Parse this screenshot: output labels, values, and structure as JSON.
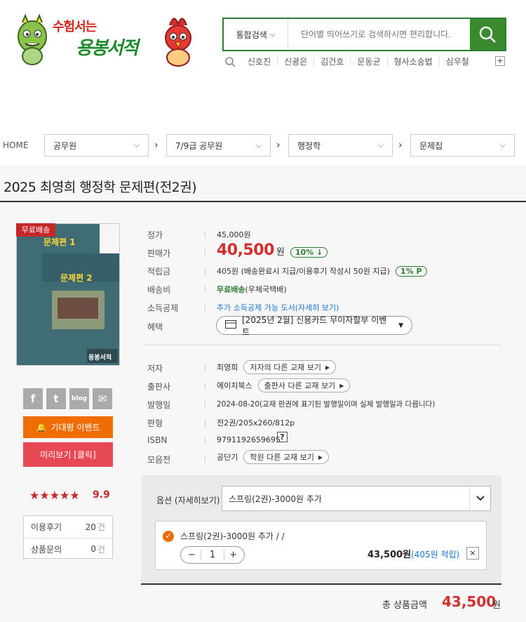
{
  "header": {
    "logo_line1": "수험서는",
    "logo_line2": "용봉서적",
    "search_scope": "통합검색",
    "search_placeholder": "단어별 띄어쓰기로 검색하시면 편리합니다.",
    "keywords": [
      "신호진",
      "신광은",
      "김건호",
      "문동균",
      "형사소송법",
      "심우철"
    ],
    "more_label": "+"
  },
  "breadcrumb": {
    "home": "HOME",
    "levels": [
      "공무원",
      "7/9급 공무원",
      "행정학",
      "문제집"
    ]
  },
  "product": {
    "title": "2025 최영희 행정학 문제편(전2권)",
    "free_badge": "무료배송",
    "cover_vol1": "문제편 1",
    "cover_vol2": "문제편 2",
    "cover_logo": "용봉서적",
    "fields": {
      "list_price_label": "정가",
      "list_price": "45,000원",
      "sale_price_label": "판매가",
      "sale_price": "40,500",
      "sale_unit": "원",
      "discount": "10%",
      "points_label": "적립금",
      "points": "405원 (배송완료시 지급/이용후기 작성시 50원 지급)",
      "points_badge": "1% P",
      "shipping_label": "배송비",
      "shipping_free": "무료배송",
      "shipping_method": "(우체국택배)",
      "tax_label": "소득공제",
      "tax_text": "추가 소득공제 가능 도서(자세히 보기)",
      "benefit_label": "혜택",
      "benefit_text": "[2025년 2월] 신용카드 무이자할부 이벤트",
      "author_label": "저자",
      "author": "최영희",
      "author_more": "저자의 다른 교재 보기",
      "publisher_label": "출판사",
      "publisher": "에이치북스",
      "publisher_more": "출판사 다른 교재 보기",
      "date_label": "발행일",
      "date": "2024-08-20(교재 판권에 표기된 발행일이며 실제 발행일과 다릅니다)",
      "edition_label": "판형",
      "edition": "전2권/205x260/812p",
      "isbn_label": "ISBN",
      "isbn": "9791192659695",
      "isbn_help": "?",
      "academy_label": "모음전",
      "academy": "공단기",
      "academy_more": "학원 다른 교재 보기"
    }
  },
  "sidebar": {
    "social": [
      "f",
      "t",
      "blog",
      "✉"
    ],
    "event_button": "기대평 이벤트",
    "preview_button": "미리보기 [클릭]",
    "stars": "★★★★★",
    "rating": "9.9",
    "reviews_label": "이용후기",
    "reviews_count": "20",
    "inquiry_label": "상품문의",
    "inquiry_count": "0",
    "count_unit": "건"
  },
  "options": {
    "label": "옵션 (자세히보기)",
    "selected": "스프링(2권)-3000원 추가",
    "item_name": "스프링(2권)-3000원 추가 / /",
    "quantity": "1",
    "minus": "−",
    "plus": "+",
    "item_price": "43,500원",
    "item_points": "(405원 적립)",
    "remove": "×"
  },
  "total": {
    "label": "총 상품금액",
    "value": "43,500",
    "unit": "원"
  },
  "colors": {
    "brand_green": "#3a8a2e",
    "price_red": "#d32f2f",
    "event_orange": "#ef6c00",
    "preview_pink": "#e84855",
    "link_blue": "#1976d2"
  }
}
